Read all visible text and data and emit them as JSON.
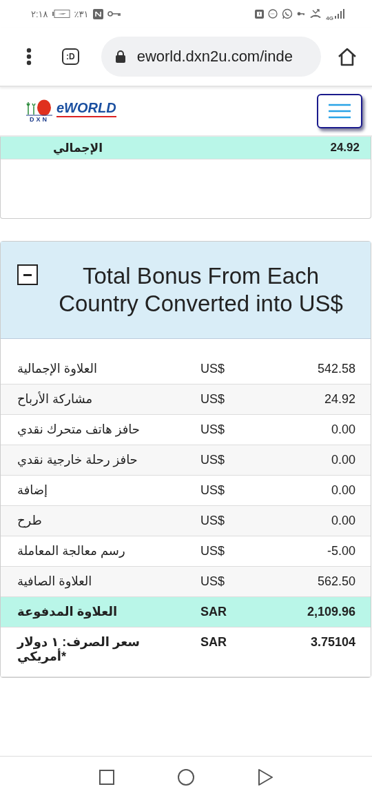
{
  "status_bar": {
    "time": "٢:١٨",
    "battery": "٣١٪",
    "network": "4G"
  },
  "browser": {
    "tab_switcher": ":D",
    "url": "eworld.dxn2u.com/inde"
  },
  "header": {
    "logo_small": "DXN",
    "logo": "eWORLD"
  },
  "summary_card": {
    "rows": [
      {
        "label": "الإجمالي",
        "value": "24.92"
      }
    ]
  },
  "bonus_panel": {
    "title": "Total Bonus From Each Country Converted into US$",
    "expanded": true,
    "rows": [
      {
        "kind": "plain",
        "label": "العلاوة الإجمالية",
        "currency": "US$",
        "amount": "542.58"
      },
      {
        "kind": "plain",
        "label": "مشاركة الأرباح",
        "currency": "US$",
        "amount": "24.92"
      },
      {
        "kind": "plain",
        "label": "حافز هاتف متحرك نقدي",
        "currency": "US$",
        "amount": "0.00"
      },
      {
        "kind": "plain",
        "label": "حافز رحلة خارجية نقدي",
        "currency": "US$",
        "amount": "0.00"
      },
      {
        "kind": "plain",
        "label": "إضافة",
        "currency": "US$",
        "amount": "0.00"
      },
      {
        "kind": "plain",
        "label": "طرح",
        "currency": "US$",
        "amount": "0.00"
      },
      {
        "kind": "plain",
        "label": "رسم معالجة المعاملة",
        "currency": "US$",
        "amount": "-5.00"
      },
      {
        "kind": "plain",
        "label": "العلاوة الصافية",
        "currency": "US$",
        "amount": "562.50"
      },
      {
        "kind": "highlight",
        "label": "العلاوة المدفوعة",
        "currency": "SAR",
        "amount": "2,109.96"
      },
      {
        "kind": "bold",
        "label": "سعر الصرف: ١ دولار أمريكي*",
        "currency": "SAR",
        "amount": "3.75104"
      }
    ]
  }
}
